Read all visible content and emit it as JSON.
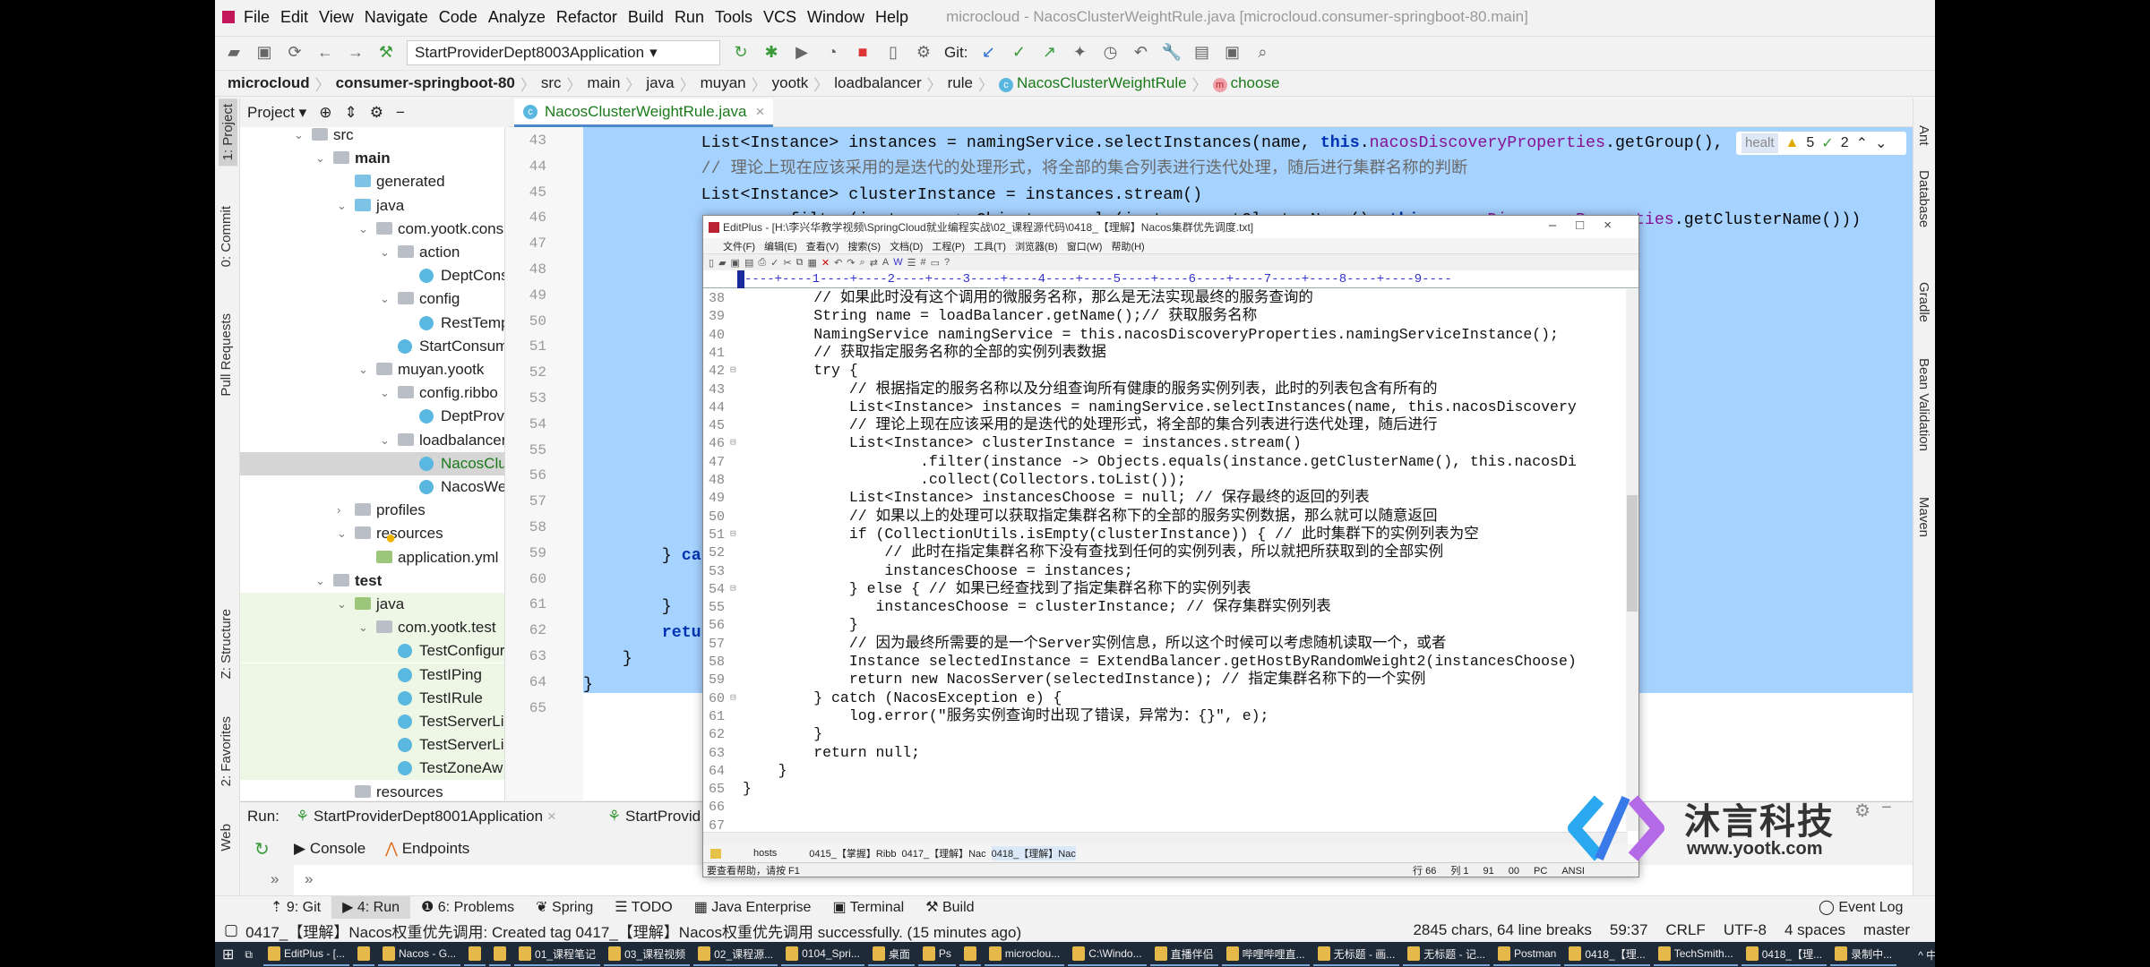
{
  "ide": {
    "menu": [
      "File",
      "Edit",
      "View",
      "Navigate",
      "Code",
      "Analyze",
      "Refactor",
      "Build",
      "Run",
      "Tools",
      "VCS",
      "Window",
      "Help"
    ],
    "window_title": "microcloud - NacosClusterWeightRule.java [microcloud.consumer-springboot-80.main]",
    "run_config": "StartProviderDept8003Application",
    "git_label": "Git:",
    "breadcrumb": [
      "microcloud",
      "consumer-springboot-80",
      "src",
      "main",
      "java",
      "muyan",
      "yootk",
      "loadbalancer",
      "rule",
      "NacosClusterWeightRule",
      "choose"
    ],
    "left_strip": [
      "1: Project",
      "0: Commit",
      "Pull Requests",
      "Z: Structure",
      "2: Favorites",
      "Web"
    ],
    "right_strip": [
      "Ant",
      "Database",
      "Gradle",
      "Bean Validation",
      "Maven"
    ],
    "project_header": "Project",
    "tree": [
      {
        "label": "src",
        "level": 0,
        "icon": "folder",
        "open": true
      },
      {
        "label": "main",
        "level": 1,
        "icon": "folder",
        "open": true,
        "bold": true
      },
      {
        "label": "generated",
        "level": 2,
        "icon": "bfolder"
      },
      {
        "label": "java",
        "level": 2,
        "icon": "bfolder",
        "open": true
      },
      {
        "label": "com.yootk.cons",
        "level": 3,
        "icon": "folder",
        "open": true
      },
      {
        "label": "action",
        "level": 4,
        "icon": "folder",
        "open": true
      },
      {
        "label": "DeptCons",
        "level": 5,
        "icon": "cls"
      },
      {
        "label": "config",
        "level": 4,
        "icon": "folder",
        "open": true
      },
      {
        "label": "RestTemp",
        "level": 5,
        "icon": "cls"
      },
      {
        "label": "StartConsum",
        "level": 4,
        "icon": "cls"
      },
      {
        "label": "muyan.yootk",
        "level": 3,
        "icon": "folder",
        "open": true
      },
      {
        "label": "config.ribbo",
        "level": 4,
        "icon": "folder",
        "open": true
      },
      {
        "label": "DeptProv",
        "level": 5,
        "icon": "cls"
      },
      {
        "label": "loadbalancer",
        "level": 4,
        "icon": "folder",
        "open": true
      },
      {
        "label": "NacosClu",
        "level": 5,
        "icon": "cls",
        "selected": true
      },
      {
        "label": "NacosWe",
        "level": 5,
        "icon": "cls"
      },
      {
        "label": "profiles",
        "level": 2,
        "icon": "folder",
        "open": false
      },
      {
        "label": "resources",
        "level": 2,
        "icon": "folder",
        "open": true
      },
      {
        "label": "application.yml",
        "level": 3,
        "icon": "gfolder"
      },
      {
        "label": "test",
        "level": 1,
        "icon": "folder",
        "open": true,
        "bold": true
      },
      {
        "label": "java",
        "level": 2,
        "icon": "gfolder",
        "open": true,
        "test": true
      },
      {
        "label": "com.yootk.test",
        "level": 3,
        "icon": "folder",
        "open": true,
        "test": true
      },
      {
        "label": "TestConfigur",
        "level": 4,
        "icon": "cls",
        "test": true
      },
      {
        "label": "TestIPing",
        "level": 4,
        "icon": "cls",
        "test": true
      },
      {
        "label": "TestIRule",
        "level": 4,
        "icon": "cls",
        "test": true
      },
      {
        "label": "TestServerLi",
        "level": 4,
        "icon": "cls",
        "test": true
      },
      {
        "label": "TestServerLi",
        "level": 4,
        "icon": "cls",
        "test": true
      },
      {
        "label": "TestZoneAw",
        "level": 4,
        "icon": "cls",
        "test": true
      },
      {
        "label": "resources",
        "level": 2,
        "icon": "folder"
      }
    ],
    "editor_tab": "NacosClusterWeightRule.java",
    "gutter_start": 43,
    "code": [
      "            List<Instance> instances = namingService.selectInstances(name, this.nacosDiscoveryProperties.getGroup(),",
      "            // 理论上现在应该采用的是迭代的处理形式，将全部的集合列表进行迭代处理，随后进行集群名称的判断",
      "            List<Instance> clusterInstance = instances.stream()",
      "                    .filter(instance -> Objects.equals(instance.getClusterName(), this.nacosDiscoveryProperties.getClusterName()))",
      "",
      "",
      "",
      "",
      "",
      "",
      "",
      "",
      "",
      "",
      "",
      "",
      "        } catch (NacosException e) {",
      "",
      "        }",
      "        return null;",
      "    }",
      "}"
    ],
    "inlay_hint": "healt",
    "inspections": {
      "warnings": "5",
      "ok": "2"
    },
    "run": {
      "label": "Run:",
      "tabs": [
        "StartProviderDept8001Application",
        "StartProvid"
      ],
      "subtabs": [
        "Console",
        "Endpoints"
      ]
    },
    "bottom_tabs": [
      "9: Git",
      "4: Run",
      "6: Problems",
      "Spring",
      "TODO",
      "Java Enterprise",
      "Terminal",
      "Build"
    ],
    "event_log": "Event Log",
    "status_message": "0417_【理解】Nacos权重优先调用: Created tag 0417_【理解】Nacos权重优先调用 successfully. (15 minutes ago)",
    "status_right": [
      "2845 chars, 64 line breaks",
      "59:37",
      "CRLF",
      "UTF-8",
      "4 spaces",
      "master"
    ]
  },
  "editplus": {
    "title": "EditPlus - [H:\\李兴华教学视频\\SpringCloud就业编程实战\\02_课程源代码\\0418_【理解】Nacos集群优先调度.txt]",
    "menu": [
      "文件(F)",
      "编辑(E)",
      "查看(V)",
      "搜索(S)",
      "文档(D)",
      "工程(P)",
      "工具(T)",
      "浏览器(B)",
      "窗口(W)",
      "帮助(H)"
    ],
    "ruler": "----+----1----+----2----+----3----+----4----+----5----+----6----+----7----+----8----+----9----",
    "first_line": 38,
    "lines": [
      "        // 如果此时没有这个调用的微服务名称，那么是无法实现最终的服务查询的",
      "        String name = loadBalancer.getName();// 获取服务名称",
      "        NamingService namingService = this.nacosDiscoveryProperties.namingServiceInstance();",
      "        // 获取指定服务名称的全部的实例列表数据",
      "        try {",
      "            // 根据指定的服务名称以及分组查询所有健康的服务实例列表，此时的列表包含有所有的",
      "            List<Instance> instances = namingService.selectInstances(name, this.nacosDiscovery",
      "            // 理论上现在应该采用的是迭代的处理形式，将全部的集合列表进行迭代处理，随后进行",
      "            List<Instance> clusterInstance = instances.stream()",
      "                    .filter(instance -> Objects.equals(instance.getClusterName(), this.nacosDi",
      "                    .collect(Collectors.toList());",
      "            List<Instance> instancesChoose = null; // 保存最终的返回的列表",
      "            // 如果以上的处理可以获取指定集群名称下的全部的服务实例数据，那么就可以随意返回",
      "            if (CollectionUtils.isEmpty(clusterInstance)) { // 此时集群下的实例列表为空",
      "                // 此时在指定集群名称下没有查找到任何的实例列表，所以就把所获取到的全部实例",
      "                instancesChoose = instances;",
      "            } else { // 如果已经查找到了指定集群名称下的实例列表",
      "               instancesChoose = clusterInstance; // 保存集群实例列表",
      "            }",
      "            // 因为最终所需要的是一个Server实例信息，所以这个时候可以考虑随机读取一个，或者",
      "            Instance selectedInstance = ExtendBalancer.getHostByRandomWeight2(instancesChoose)",
      "            return new NacosServer(selectedInstance); // 指定集群名称下的一个实例",
      "        } catch (NacosException e) {",
      "            log.error(\"服务实例查询时出现了错误，异常为：{}\", e);",
      "        }",
      "        return null;",
      "    }",
      "}",
      "",
      ""
    ],
    "folds": [
      42,
      46,
      51,
      54,
      60
    ],
    "tabs": [
      "hosts",
      "0415_【掌握】Ribb",
      "0417_【理解】Nac",
      "0418_【理解】Nac"
    ],
    "status_left": "要查看帮助，请按 F1",
    "status_right": [
      "行 66",
      "列 1",
      "91",
      "00",
      "PC",
      "ANSI"
    ]
  },
  "watermark": {
    "brand": "沐言科技",
    "url": "www.yootk.com"
  },
  "taskbar": [
    "EditPlus - [...",
    "",
    "Nacos - G...",
    "",
    "",
    "01_课程笔记",
    "03_课程视频",
    "02_课程源...",
    "0104_Spri...",
    "桌面",
    "Ps",
    "",
    "microclou...",
    "C:\\Windo...",
    "直播伴侣",
    "哔哩哔哩直...",
    "无标题 - 画...",
    "无标题 - 记...",
    "Postman",
    "0418_【理...",
    "TechSmith...",
    "0418_【理...",
    "录制中..."
  ],
  "tray": "^ 中",
  "colors": {
    "selection": "#a6d2ff",
    "keyword": "#0033b3",
    "field": "#871094",
    "editor_tab": "#1a7a1a"
  }
}
